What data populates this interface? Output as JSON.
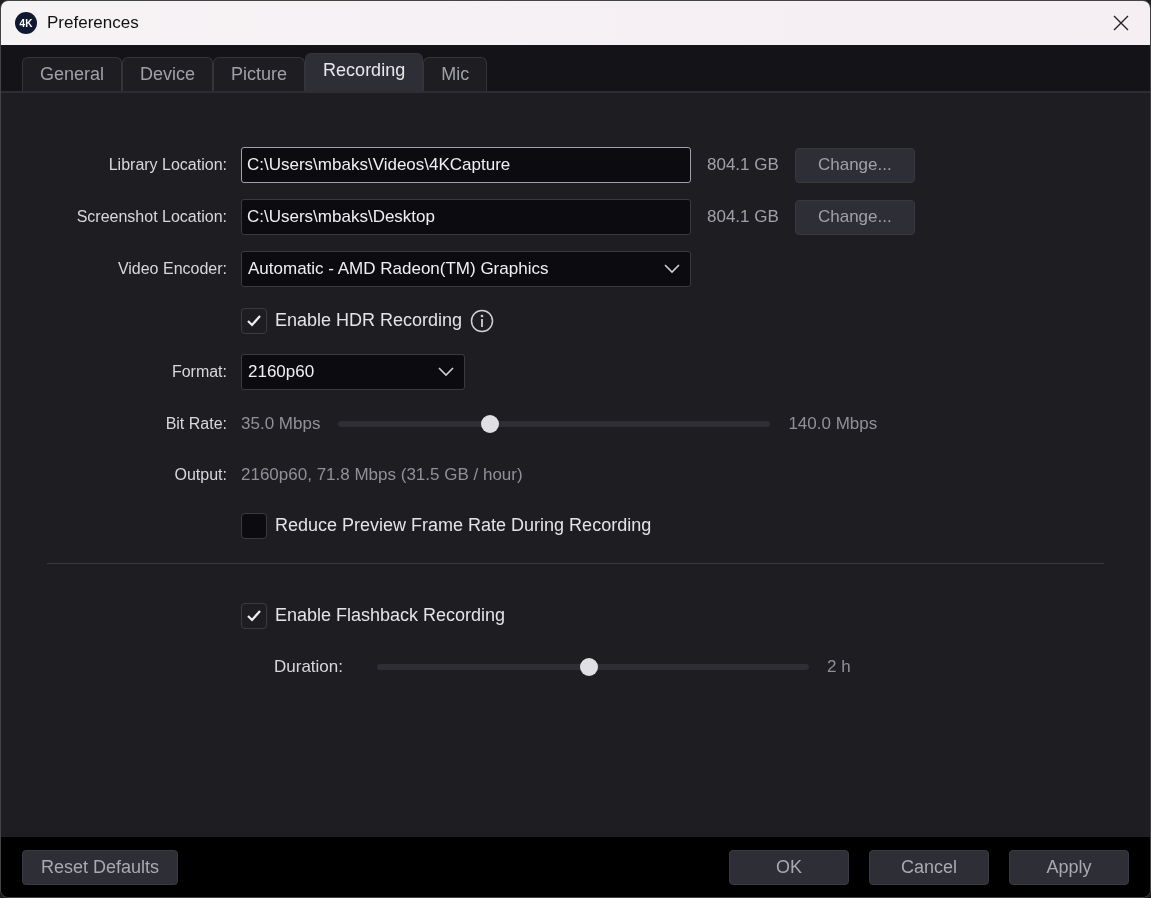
{
  "window": {
    "title": "Preferences",
    "logo": "4K"
  },
  "tabs": [
    {
      "label": "General",
      "selected": false
    },
    {
      "label": "Device",
      "selected": false
    },
    {
      "label": "Picture",
      "selected": false
    },
    {
      "label": "Recording",
      "selected": true
    },
    {
      "label": "Mic",
      "selected": false
    }
  ],
  "sections": [
    {
      "rows": [
        {
          "kind": "path",
          "label": "Library Location:",
          "value": "C:\\Users\\mbaks\\Videos\\4KCapture",
          "focused": true,
          "free": "804.1 GB",
          "button": "Change..."
        },
        {
          "kind": "path",
          "label": "Screenshot Location:",
          "value": "C:\\Users\\mbaks\\Desktop",
          "focused": false,
          "free": "804.1 GB",
          "button": "Change..."
        },
        {
          "kind": "select",
          "label": "Video Encoder:",
          "value": "Automatic - AMD Radeon(TM) Graphics",
          "wide": true
        },
        {
          "kind": "checkbox",
          "label": "Enable HDR Recording",
          "checked": true,
          "info": true
        },
        {
          "kind": "select",
          "label": "Format:",
          "value": "2160p60",
          "wide": false
        },
        {
          "kind": "slider",
          "label": "Bit Rate:",
          "min": "35.0 Mbps",
          "max": "140.0 Mbps",
          "level": 0.35
        },
        {
          "kind": "text",
          "label": "Output:",
          "value": "2160p60, 71.8 Mbps (31.5 GB / hour)"
        },
        {
          "kind": "checkbox",
          "label": "Reduce Preview Frame Rate During Recording",
          "checked": false,
          "info": false
        }
      ]
    },
    {
      "rows": [
        {
          "kind": "checkbox",
          "label": "Enable Flashback Recording",
          "checked": true,
          "info": false
        },
        {
          "kind": "inline_slider",
          "label": "Duration:",
          "reading": "2 h",
          "level": 0.49
        }
      ]
    }
  ],
  "footer": {
    "left": [
      "Reset Defaults"
    ],
    "right": [
      "OK",
      "Cancel",
      "Apply"
    ]
  }
}
